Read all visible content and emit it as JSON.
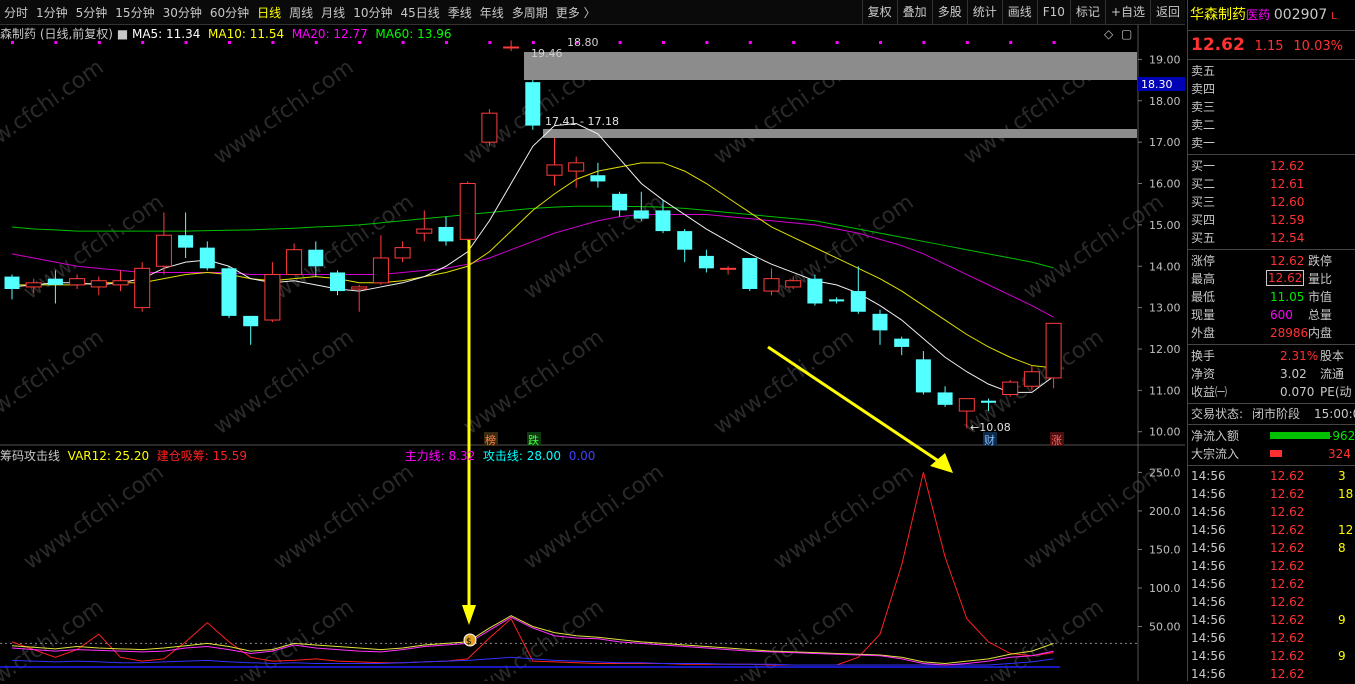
{
  "toolbar": {
    "periods": [
      "分时",
      "1分钟",
      "5分钟",
      "15分钟",
      "30分钟",
      "60分钟",
      "日线",
      "周线",
      "月线",
      "10分钟",
      "45日线",
      "季线",
      "年线",
      "多周期",
      "更多 〉"
    ],
    "active_period": "日线",
    "tools": [
      "复权",
      "叠加",
      "多股",
      "统计",
      "画线",
      "F10",
      "标记",
      "+自选",
      "返回"
    ]
  },
  "legend": {
    "name": "森制药 (日线,前复权)",
    "ma5": "MA5: 11.34",
    "ma10": "MA10: 11.54",
    "ma20": "MA20: 12.77",
    "ma60": "MA60: 13.96"
  },
  "indicator_legend": {
    "name": "筹码攻击线",
    "var12": "VAR12: 25.20",
    "jiancang": "建仓吸筹: 15.59",
    "zhuli": "主力线: 8.32",
    "gongji": "攻击线: 28.00",
    "extra": "0.00"
  },
  "price_axis": {
    "labels": [
      "19.00",
      "18.00",
      "17.00",
      "16.00",
      "15.00",
      "14.00",
      "13.00",
      "12.00",
      "11.00",
      "10.00"
    ],
    "current_tag": "18.30"
  },
  "indicator_axis": {
    "labels": [
      "250.0",
      "200.0",
      "150.0",
      "100.0",
      "50.00"
    ]
  },
  "annotations": {
    "high": "19.46",
    "high_extra": "18.80",
    "range": "17.41 - 17.18",
    "low": "←10.08",
    "tag_bang": "榜",
    "tag_die": "跌",
    "tag_cai": "财",
    "tag_zhang": "涨",
    "coin": "$"
  },
  "watermark": "www.cfchi.com",
  "side": {
    "stock_name": "华森制药",
    "tag": "医药",
    "code": "002907",
    "code_suffix": "L",
    "price": "12.62",
    "change": "1.15",
    "pct": "10.03%",
    "sell": [
      {
        "l": "卖五"
      },
      {
        "l": "卖四"
      },
      {
        "l": "卖三"
      },
      {
        "l": "卖二"
      },
      {
        "l": "卖一"
      }
    ],
    "buy": [
      {
        "l": "买一",
        "v": "12.62"
      },
      {
        "l": "买二",
        "v": "12.61"
      },
      {
        "l": "买三",
        "v": "12.60"
      },
      {
        "l": "买四",
        "v": "12.59"
      },
      {
        "l": "买五",
        "v": "12.54"
      }
    ],
    "stats": [
      {
        "l": "涨停",
        "v": "12.62",
        "r": "跌停"
      },
      {
        "l": "最高",
        "v": "12.62",
        "r": "量比"
      },
      {
        "l": "最低",
        "v": "11.05",
        "r": "市值"
      },
      {
        "l": "现量",
        "v": "600",
        "r": "总量"
      },
      {
        "l": "外盘",
        "v": "28986",
        "r": "内盘"
      }
    ],
    "stats2": [
      {
        "l": "换手",
        "v": "2.31%",
        "r": "股本"
      },
      {
        "l": "净资",
        "v": "3.02",
        "r": "流通"
      },
      {
        "l": "收益㈠",
        "v": "0.070",
        "r": "PE(动"
      }
    ],
    "status_label": "交易状态:",
    "status_value": "闭市阶段",
    "status_time": "15:00:0",
    "flows": [
      {
        "l": "净流入额",
        "v": "-962"
      },
      {
        "l": "大宗流入",
        "v": "324"
      }
    ],
    "ticks": [
      {
        "t": "14:56",
        "p": "12.62",
        "q": "3"
      },
      {
        "t": "14:56",
        "p": "12.62",
        "q": "18"
      },
      {
        "t": "14:56",
        "p": "12.62",
        "q": ""
      },
      {
        "t": "14:56",
        "p": "12.62",
        "q": "12"
      },
      {
        "t": "14:56",
        "p": "12.62",
        "q": "8"
      },
      {
        "t": "14:56",
        "p": "12.62",
        "q": ""
      },
      {
        "t": "14:56",
        "p": "12.62",
        "q": ""
      },
      {
        "t": "14:56",
        "p": "12.62",
        "q": ""
      },
      {
        "t": "14:56",
        "p": "12.62",
        "q": "9"
      },
      {
        "t": "14:56",
        "p": "12.62",
        "q": ""
      },
      {
        "t": "14:56",
        "p": "12.62",
        "q": "9"
      },
      {
        "t": "14:56",
        "p": "12.62",
        "q": ""
      }
    ]
  },
  "chart_data": {
    "type": "candlestick",
    "price_range": [
      9.8,
      19.3
    ],
    "candles": [
      [
        13.75,
        13.45,
        13.8,
        13.2
      ],
      [
        13.5,
        13.6,
        13.7,
        13.35
      ],
      [
        13.7,
        13.55,
        13.9,
        13.1
      ],
      [
        13.55,
        13.7,
        13.8,
        13.45
      ],
      [
        13.5,
        13.65,
        13.75,
        13.3
      ],
      [
        13.55,
        13.65,
        13.9,
        13.4
      ],
      [
        13.0,
        13.95,
        14.1,
        12.9
      ],
      [
        14.0,
        14.75,
        15.3,
        13.8
      ],
      [
        14.75,
        14.45,
        15.3,
        14.2
      ],
      [
        14.45,
        13.95,
        14.6,
        13.9
      ],
      [
        13.95,
        12.8,
        14.0,
        12.75
      ],
      [
        12.8,
        12.55,
        12.8,
        12.1
      ],
      [
        12.7,
        13.8,
        14.1,
        12.65
      ],
      [
        13.8,
        14.4,
        14.55,
        13.8
      ],
      [
        14.4,
        14.0,
        14.6,
        13.75
      ],
      [
        13.85,
        13.4,
        13.9,
        13.3
      ],
      [
        13.45,
        13.5,
        13.55,
        12.9
      ],
      [
        13.6,
        14.2,
        14.75,
        13.55
      ],
      [
        14.2,
        14.45,
        14.6,
        14.1
      ],
      [
        14.8,
        14.9,
        15.35,
        14.6
      ],
      [
        14.95,
        14.6,
        15.2,
        14.5
      ],
      [
        14.65,
        16.0,
        16.05,
        14.6
      ],
      [
        17.0,
        17.7,
        17.8,
        16.9
      ],
      [
        19.3,
        19.3,
        19.46,
        19.2
      ],
      [
        18.45,
        17.4,
        18.5,
        17.3
      ],
      [
        16.2,
        16.45,
        17.1,
        15.95
      ],
      [
        16.3,
        16.5,
        16.65,
        15.9
      ],
      [
        16.2,
        16.05,
        16.5,
        15.9
      ],
      [
        15.75,
        15.35,
        15.8,
        15.2
      ],
      [
        15.35,
        15.15,
        15.8,
        15.1
      ],
      [
        15.35,
        14.85,
        15.6,
        14.8
      ],
      [
        14.85,
        14.4,
        14.9,
        14.1
      ],
      [
        14.25,
        13.95,
        14.4,
        13.85
      ],
      [
        13.95,
        13.95,
        14.0,
        13.8
      ],
      [
        14.2,
        13.45,
        14.2,
        13.4
      ],
      [
        13.4,
        13.7,
        13.95,
        13.3
      ],
      [
        13.5,
        13.65,
        13.75,
        13.45
      ],
      [
        13.7,
        13.1,
        13.8,
        13.05
      ],
      [
        13.2,
        13.15,
        13.25,
        13.1
      ],
      [
        13.4,
        12.9,
        14.0,
        12.85
      ],
      [
        12.85,
        12.45,
        12.95,
        12.1
      ],
      [
        12.25,
        12.05,
        12.3,
        11.85
      ],
      [
        11.75,
        10.95,
        11.95,
        10.9
      ],
      [
        10.95,
        10.65,
        11.1,
        10.6
      ],
      [
        10.5,
        10.8,
        10.8,
        10.08
      ],
      [
        10.75,
        10.7,
        10.8,
        10.5
      ],
      [
        10.9,
        11.2,
        11.25,
        10.85
      ],
      [
        11.1,
        11.45,
        11.6,
        11.0
      ],
      [
        11.3,
        12.62,
        12.62,
        11.05
      ]
    ],
    "ma5": [
      13.5,
      13.55,
      13.6,
      13.6,
      13.55,
      13.6,
      13.7,
      13.95,
      14.1,
      14.15,
      14.0,
      13.7,
      13.6,
      13.65,
      13.55,
      13.45,
      13.4,
      13.5,
      13.6,
      13.75,
      14.0,
      14.35,
      15.1,
      16.0,
      16.9,
      17.4,
      17.45,
      17.2,
      16.6,
      16.0,
      15.6,
      15.25,
      14.9,
      14.6,
      14.3,
      14.05,
      13.85,
      13.65,
      13.55,
      13.35,
      13.05,
      12.7,
      12.25,
      11.8,
      11.45,
      11.15,
      10.95,
      10.95,
      11.34
    ],
    "ma10": [
      13.55,
      13.55,
      13.55,
      13.55,
      13.6,
      13.6,
      13.6,
      13.7,
      13.8,
      13.85,
      13.8,
      13.7,
      13.65,
      13.7,
      13.75,
      13.7,
      13.6,
      13.6,
      13.65,
      13.75,
      13.85,
      14.0,
      14.35,
      14.85,
      15.35,
      15.75,
      16.1,
      16.3,
      16.4,
      16.5,
      16.5,
      16.3,
      16.0,
      15.65,
      15.3,
      14.95,
      14.7,
      14.45,
      14.2,
      13.95,
      13.7,
      13.4,
      13.05,
      12.7,
      12.35,
      12.05,
      11.8,
      11.6,
      11.54
    ],
    "ma20": [
      14.3,
      14.2,
      14.1,
      14.0,
      13.95,
      13.9,
      13.85,
      13.85,
      13.85,
      13.85,
      13.85,
      13.8,
      13.8,
      13.8,
      13.8,
      13.8,
      13.8,
      13.8,
      13.85,
      13.9,
      13.95,
      14.05,
      14.2,
      14.4,
      14.6,
      14.8,
      14.95,
      15.1,
      15.2,
      15.25,
      15.25,
      15.25,
      15.25,
      15.2,
      15.15,
      15.1,
      15.05,
      15.0,
      14.9,
      14.8,
      14.65,
      14.5,
      14.3,
      14.05,
      13.8,
      13.55,
      13.3,
      13.05,
      12.77
    ],
    "ma60": [
      14.95,
      14.9,
      14.88,
      14.85,
      14.85,
      14.85,
      14.85,
      14.85,
      14.85,
      14.86,
      14.87,
      14.88,
      14.9,
      14.92,
      14.95,
      14.97,
      15.0,
      15.05,
      15.1,
      15.15,
      15.2,
      15.25,
      15.3,
      15.35,
      15.4,
      15.43,
      15.45,
      15.45,
      15.45,
      15.44,
      15.43,
      15.4,
      15.35,
      15.3,
      15.25,
      15.2,
      15.15,
      15.1,
      15.0,
      14.9,
      14.8,
      14.7,
      14.6,
      14.5,
      14.4,
      14.3,
      14.2,
      14.1,
      13.96
    ],
    "indicator_range": [
      0,
      270
    ],
    "zhuli": [
      22,
      20,
      18,
      20,
      19,
      18,
      17,
      18,
      22,
      24,
      20,
      15,
      18,
      26,
      22,
      20,
      18,
      17,
      20,
      24,
      26,
      28,
      45,
      62,
      48,
      38,
      35,
      34,
      30,
      28,
      26,
      24,
      22,
      20,
      18,
      17,
      16,
      15,
      14,
      13,
      12,
      8,
      2,
      0,
      2,
      5,
      10,
      12,
      18
    ],
    "gongji": [
      25,
      23,
      21,
      24,
      22,
      21,
      20,
      22,
      25,
      28,
      24,
      18,
      20,
      28,
      26,
      24,
      22,
      20,
      22,
      26,
      28,
      30,
      48,
      64,
      50,
      42,
      38,
      36,
      33,
      30,
      28,
      26,
      24,
      22,
      20,
      18,
      17,
      16,
      15,
      14,
      13,
      10,
      4,
      2,
      5,
      8,
      14,
      18,
      28
    ],
    "jiancang": [
      30,
      20,
      10,
      20,
      40,
      10,
      5,
      8,
      30,
      55,
      30,
      10,
      5,
      6,
      8,
      5,
      4,
      3,
      3,
      4,
      5,
      8,
      35,
      60,
      5,
      4,
      3,
      2,
      2,
      2,
      2,
      1,
      1,
      1,
      1,
      0,
      0,
      0,
      0,
      10,
      40,
      130,
      250,
      140,
      60,
      30,
      15,
      12,
      16
    ],
    "var12": [
      6,
      5,
      4,
      5,
      4,
      3,
      3,
      4,
      5,
      6,
      4,
      3,
      2,
      3,
      2,
      2,
      2,
      2,
      3,
      4,
      5,
      6,
      8,
      10,
      8,
      6,
      5,
      4,
      3,
      3,
      2,
      2,
      2,
      1,
      1,
      1,
      0,
      0,
      0,
      0,
      0,
      0,
      0,
      0,
      0,
      0,
      2,
      4,
      8
    ]
  }
}
